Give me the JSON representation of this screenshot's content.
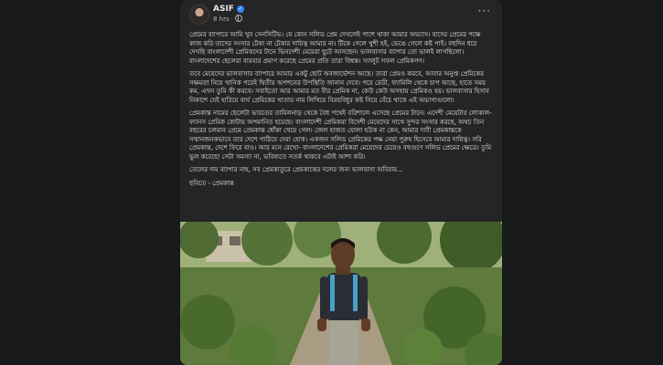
{
  "post": {
    "author": "ASIF",
    "time": "8 hrs",
    "paragraphs": [
      "প্রেমের ব্যাপারে আমি খুব সেনসিটিভ। যে কোন সলিড প্রেম দেখলেই পাশে থাকা আমার অভ্যাস। যাদের প্রেমের পক্ষে কাজ করি তাদের সংসার টেকা না টেকার দায়িত্ব আমার না। টিকে গেলে খুশী হই, ভেঙে গেলে কষ্ট পাই। বহুদিন ধরে দেখছি বাংলাদেশী প্রেমিকদের টানে ভিনদেশী মেয়েরা ছুটে আসছেন। ভালবাসার ব্যাপার তো ভালই লাগছিলো। বাংলাদেশের ছেলেরা বারবার প্রমাণ করেছে প্রেমের প্রতি তারা বিশ্বস্ত। স্যালুট সফল প্রেমিকগণ।",
      "তবে মেয়েদের ভালবাসার ব্যাপারে আমার একটু ছোট অবজার্ভেশন আছে। তারা প্রেমও করবে, আবার অনুপ্ত প্রেমিকের সক্ষমতা নিয়ে খানিক পরেই দ্বিতীয় অপশনের উপস্থিতি জানান দেবে। পরে রেডী, ফ্যামিলি থেকে চাপ আছে, হাতে সময় কম, এখন তুমি কী করবে। সবাইতো আর আমার মত বীর প্রেমিক না, কেউ কেউ অসহায় প্রেমিকও হয়। ভালবাসার হিসাব নিকাশে যেই হারিয়ে ব্যর্থ প্রেমিকের খাতায় নাম লিখিয়ে বিরহবিধুর কষ্ট নিয়ে বেঁচে থাকে এই অভাগাগুলো।",
      "প্রেমকান্ত নামের ছেলেটা ভারতের তামিলনাড় থেকে বৈধ পথেই বরিশালে এসেছে প্রেমের টানে। এদেশী মেয়েটার লোকাল- ফ্যানস প্রেমিক কোটায় অপমানিত হয়েছে। বাংলাদেশী প্রেমিকরা বিদেশী মেয়েদের সাথে সুন্দর সংসার করছে, অথচ তিন বছরের চলমান প্রেমে প্রেমকান্ত ধোঁকা খেয়ে গেল। জেল হাজত যোলা হউক না কেন, আমার দাবী প্রেমকান্তকে সম্মানজনকভাবে তার দেশে পাঠিয়ে দেয়া হোক। একজন সলিড প্রেমিকের পক্ষ নেয়া পুরুষ হিসেবে আমার দায়িত্ব। সরি প্রেমকান্ত, দেশে ফিরে যাও। আর মনে রেখো- বাংলাদেশের প্রেমিকরা মেয়েদের চেয়েও বহুগুণে সলিড প্রেমের ক্ষেত্রে। তুমি ভুল করেছো সেটা সমস্যা না, ভবিষ্যতে সতর্ক থাকবে এটাই আশা করি।",
      "তেলের দাম ব্যাপার নাহ, সব প্রেমকাতুরে প্রেমকান্তের দলের জন্য ভালবাসা অবিরাম..."
    ],
    "caption": "ছবিতে - প্রেমকান্ত"
  },
  "colors": {
    "page_bg": "#18191a",
    "card_bg": "#242526",
    "text_primary": "#e4e6eb",
    "text_secondary": "#b0b3b8",
    "verified_badge": "#2d88ff"
  },
  "icons": {
    "verified": "verified-badge-icon",
    "privacy": "globe-icon",
    "more": "more-options-icon"
  }
}
